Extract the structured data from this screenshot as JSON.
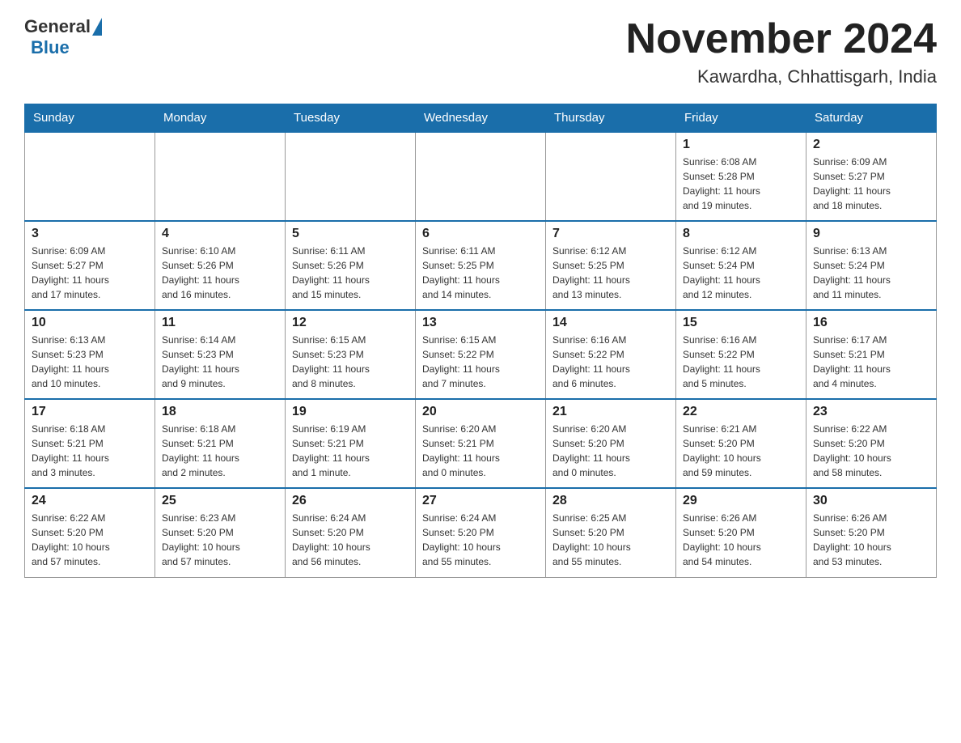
{
  "header": {
    "logo_general": "General",
    "logo_blue": "Blue",
    "month_title": "November 2024",
    "location": "Kawardha, Chhattisgarh, India"
  },
  "weekdays": [
    "Sunday",
    "Monday",
    "Tuesday",
    "Wednesday",
    "Thursday",
    "Friday",
    "Saturday"
  ],
  "weeks": [
    [
      {
        "day": "",
        "info": ""
      },
      {
        "day": "",
        "info": ""
      },
      {
        "day": "",
        "info": ""
      },
      {
        "day": "",
        "info": ""
      },
      {
        "day": "",
        "info": ""
      },
      {
        "day": "1",
        "info": "Sunrise: 6:08 AM\nSunset: 5:28 PM\nDaylight: 11 hours\nand 19 minutes."
      },
      {
        "day": "2",
        "info": "Sunrise: 6:09 AM\nSunset: 5:27 PM\nDaylight: 11 hours\nand 18 minutes."
      }
    ],
    [
      {
        "day": "3",
        "info": "Sunrise: 6:09 AM\nSunset: 5:27 PM\nDaylight: 11 hours\nand 17 minutes."
      },
      {
        "day": "4",
        "info": "Sunrise: 6:10 AM\nSunset: 5:26 PM\nDaylight: 11 hours\nand 16 minutes."
      },
      {
        "day": "5",
        "info": "Sunrise: 6:11 AM\nSunset: 5:26 PM\nDaylight: 11 hours\nand 15 minutes."
      },
      {
        "day": "6",
        "info": "Sunrise: 6:11 AM\nSunset: 5:25 PM\nDaylight: 11 hours\nand 14 minutes."
      },
      {
        "day": "7",
        "info": "Sunrise: 6:12 AM\nSunset: 5:25 PM\nDaylight: 11 hours\nand 13 minutes."
      },
      {
        "day": "8",
        "info": "Sunrise: 6:12 AM\nSunset: 5:24 PM\nDaylight: 11 hours\nand 12 minutes."
      },
      {
        "day": "9",
        "info": "Sunrise: 6:13 AM\nSunset: 5:24 PM\nDaylight: 11 hours\nand 11 minutes."
      }
    ],
    [
      {
        "day": "10",
        "info": "Sunrise: 6:13 AM\nSunset: 5:23 PM\nDaylight: 11 hours\nand 10 minutes."
      },
      {
        "day": "11",
        "info": "Sunrise: 6:14 AM\nSunset: 5:23 PM\nDaylight: 11 hours\nand 9 minutes."
      },
      {
        "day": "12",
        "info": "Sunrise: 6:15 AM\nSunset: 5:23 PM\nDaylight: 11 hours\nand 8 minutes."
      },
      {
        "day": "13",
        "info": "Sunrise: 6:15 AM\nSunset: 5:22 PM\nDaylight: 11 hours\nand 7 minutes."
      },
      {
        "day": "14",
        "info": "Sunrise: 6:16 AM\nSunset: 5:22 PM\nDaylight: 11 hours\nand 6 minutes."
      },
      {
        "day": "15",
        "info": "Sunrise: 6:16 AM\nSunset: 5:22 PM\nDaylight: 11 hours\nand 5 minutes."
      },
      {
        "day": "16",
        "info": "Sunrise: 6:17 AM\nSunset: 5:21 PM\nDaylight: 11 hours\nand 4 minutes."
      }
    ],
    [
      {
        "day": "17",
        "info": "Sunrise: 6:18 AM\nSunset: 5:21 PM\nDaylight: 11 hours\nand 3 minutes."
      },
      {
        "day": "18",
        "info": "Sunrise: 6:18 AM\nSunset: 5:21 PM\nDaylight: 11 hours\nand 2 minutes."
      },
      {
        "day": "19",
        "info": "Sunrise: 6:19 AM\nSunset: 5:21 PM\nDaylight: 11 hours\nand 1 minute."
      },
      {
        "day": "20",
        "info": "Sunrise: 6:20 AM\nSunset: 5:21 PM\nDaylight: 11 hours\nand 0 minutes."
      },
      {
        "day": "21",
        "info": "Sunrise: 6:20 AM\nSunset: 5:20 PM\nDaylight: 11 hours\nand 0 minutes."
      },
      {
        "day": "22",
        "info": "Sunrise: 6:21 AM\nSunset: 5:20 PM\nDaylight: 10 hours\nand 59 minutes."
      },
      {
        "day": "23",
        "info": "Sunrise: 6:22 AM\nSunset: 5:20 PM\nDaylight: 10 hours\nand 58 minutes."
      }
    ],
    [
      {
        "day": "24",
        "info": "Sunrise: 6:22 AM\nSunset: 5:20 PM\nDaylight: 10 hours\nand 57 minutes."
      },
      {
        "day": "25",
        "info": "Sunrise: 6:23 AM\nSunset: 5:20 PM\nDaylight: 10 hours\nand 57 minutes."
      },
      {
        "day": "26",
        "info": "Sunrise: 6:24 AM\nSunset: 5:20 PM\nDaylight: 10 hours\nand 56 minutes."
      },
      {
        "day": "27",
        "info": "Sunrise: 6:24 AM\nSunset: 5:20 PM\nDaylight: 10 hours\nand 55 minutes."
      },
      {
        "day": "28",
        "info": "Sunrise: 6:25 AM\nSunset: 5:20 PM\nDaylight: 10 hours\nand 55 minutes."
      },
      {
        "day": "29",
        "info": "Sunrise: 6:26 AM\nSunset: 5:20 PM\nDaylight: 10 hours\nand 54 minutes."
      },
      {
        "day": "30",
        "info": "Sunrise: 6:26 AM\nSunset: 5:20 PM\nDaylight: 10 hours\nand 53 minutes."
      }
    ]
  ]
}
